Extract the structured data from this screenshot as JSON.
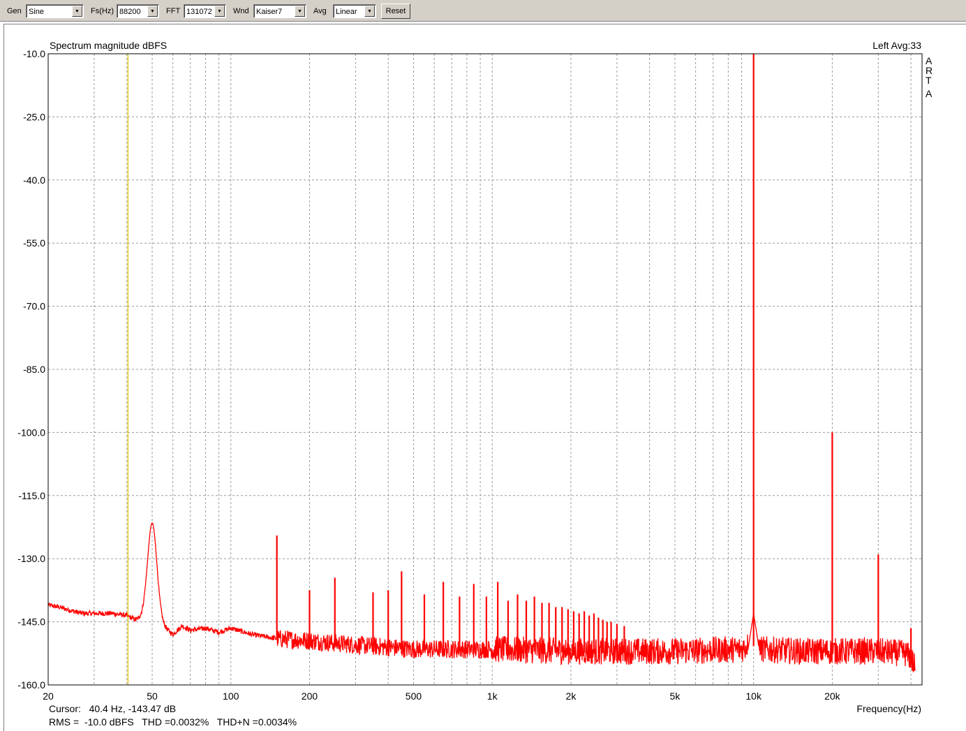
{
  "toolbar": {
    "gen_label": "Gen",
    "gen_value": "Sine",
    "fs_label": "Fs(Hz)",
    "fs_value": "88200",
    "fft_label": "FFT",
    "fft_value": "131072",
    "wnd_label": "Wnd",
    "wnd_value": "Kaiser7",
    "avg_label": "Avg",
    "avg_value": "Linear",
    "reset_label": "Reset"
  },
  "chart": {
    "title": "Spectrum magnitude dBFS",
    "channel_info": "Left  Avg:33",
    "watermark": [
      "A",
      "R",
      "T",
      "A"
    ],
    "xlabel": "Frequency(Hz)",
    "cursor_text": "Cursor:   40.4 Hz, -143.47 dB",
    "stats_text": "RMS =  -10.0 dBFS   THD =0.0032%   THD+N =0.0034%",
    "trace_color": "#ff0000",
    "cursor_color": "#e0c000",
    "stats_color": "#c00000"
  },
  "chart_data": {
    "type": "line",
    "xscale": "log",
    "xlim": [
      20,
      44100
    ],
    "ylim": [
      -160,
      -10
    ],
    "grid": true,
    "y_ticks": [
      "-10.0",
      "-25.0",
      "-40.0",
      "-55.0",
      "-70.0",
      "-85.0",
      "-100.0",
      "-115.0",
      "-130.0",
      "-145.0",
      "-160.0"
    ],
    "x_tick_labels": [
      {
        "f": 20,
        "label": "20"
      },
      {
        "f": 50,
        "label": "50"
      },
      {
        "f": 100,
        "label": "100"
      },
      {
        "f": 200,
        "label": "200"
      },
      {
        "f": 500,
        "label": "500"
      },
      {
        "f": 1000,
        "label": "1k"
      },
      {
        "f": 2000,
        "label": "2k"
      },
      {
        "f": 5000,
        "label": "5k"
      },
      {
        "f": 10000,
        "label": "10k"
      },
      {
        "f": 20000,
        "label": "20k"
      }
    ],
    "cursor_x": 40.4,
    "noise_floor": [
      [
        20,
        -141
      ],
      [
        22,
        -141.5
      ],
      [
        25,
        -142.5
      ],
      [
        27,
        -143
      ],
      [
        30,
        -143
      ],
      [
        35,
        -143
      ],
      [
        40,
        -143.5
      ],
      [
        43,
        -144.5
      ],
      [
        47,
        -144
      ],
      [
        55,
        -146
      ],
      [
        60,
        -148
      ],
      [
        65,
        -146
      ],
      [
        70,
        -147
      ],
      [
        80,
        -146.5
      ],
      [
        90,
        -147.5
      ],
      [
        100,
        -146.5
      ],
      [
        120,
        -148
      ],
      [
        150,
        -149
      ],
      [
        200,
        -149.5
      ],
      [
        300,
        -150.5
      ],
      [
        500,
        -151.5
      ],
      [
        1000,
        -151.5
      ],
      [
        2000,
        -152
      ],
      [
        5000,
        -152
      ],
      [
        9000,
        -151.5
      ],
      [
        9800,
        -150
      ],
      [
        10500,
        -151.5
      ],
      [
        15000,
        -152
      ],
      [
        20000,
        -152
      ],
      [
        30000,
        -152
      ],
      [
        38000,
        -152.5
      ],
      [
        40000,
        -153.5
      ],
      [
        41500,
        -156
      ]
    ],
    "peaks": [
      {
        "f": 50,
        "db": -121.5,
        "w": 0.05
      },
      {
        "f": 150,
        "db": -124.5
      },
      {
        "f": 200,
        "db": -137.5
      },
      {
        "f": 250,
        "db": -134.5
      },
      {
        "f": 350,
        "db": -138
      },
      {
        "f": 400,
        "db": -137.5
      },
      {
        "f": 450,
        "db": -133
      },
      {
        "f": 550,
        "db": -138.5
      },
      {
        "f": 650,
        "db": -135.5
      },
      {
        "f": 750,
        "db": -139
      },
      {
        "f": 850,
        "db": -136
      },
      {
        "f": 950,
        "db": -139
      },
      {
        "f": 1050,
        "db": -135.5
      },
      {
        "f": 1150,
        "db": -140
      },
      {
        "f": 1250,
        "db": -138.5
      },
      {
        "f": 1350,
        "db": -140
      },
      {
        "f": 1450,
        "db": -139
      },
      {
        "f": 1550,
        "db": -140.5
      },
      {
        "f": 1650,
        "db": -140.5
      },
      {
        "f": 1750,
        "db": -141.5
      },
      {
        "f": 1850,
        "db": -141.5
      },
      {
        "f": 1950,
        "db": -142
      },
      {
        "f": 2050,
        "db": -142.5
      },
      {
        "f": 2150,
        "db": -143
      },
      {
        "f": 2250,
        "db": -142.5
      },
      {
        "f": 2350,
        "db": -143.5
      },
      {
        "f": 2450,
        "db": -143
      },
      {
        "f": 2550,
        "db": -144
      },
      {
        "f": 2650,
        "db": -144.5
      },
      {
        "f": 2750,
        "db": -145
      },
      {
        "f": 2850,
        "db": -145
      },
      {
        "f": 3000,
        "db": -145.5
      },
      {
        "f": 3200,
        "db": -146
      },
      {
        "f": 10000,
        "db": -10
      },
      {
        "f": 20000,
        "db": -100
      },
      {
        "f": 30000,
        "db": -129
      },
      {
        "f": 40000,
        "db": -146.5
      }
    ]
  }
}
